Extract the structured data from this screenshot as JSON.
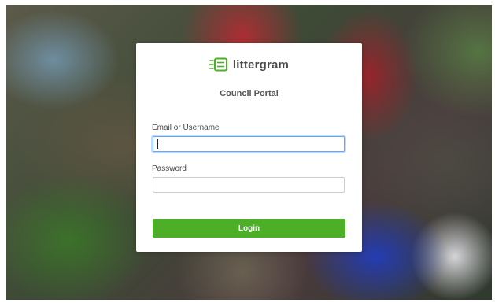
{
  "brand": {
    "name": "littergram",
    "icon": "littergram-logo-icon",
    "accent_color": "#4caf27"
  },
  "portal": {
    "title": "Council Portal"
  },
  "form": {
    "email_label": "Email or Username",
    "email_value": "",
    "password_label": "Password",
    "password_value": "",
    "login_label": "Login"
  }
}
